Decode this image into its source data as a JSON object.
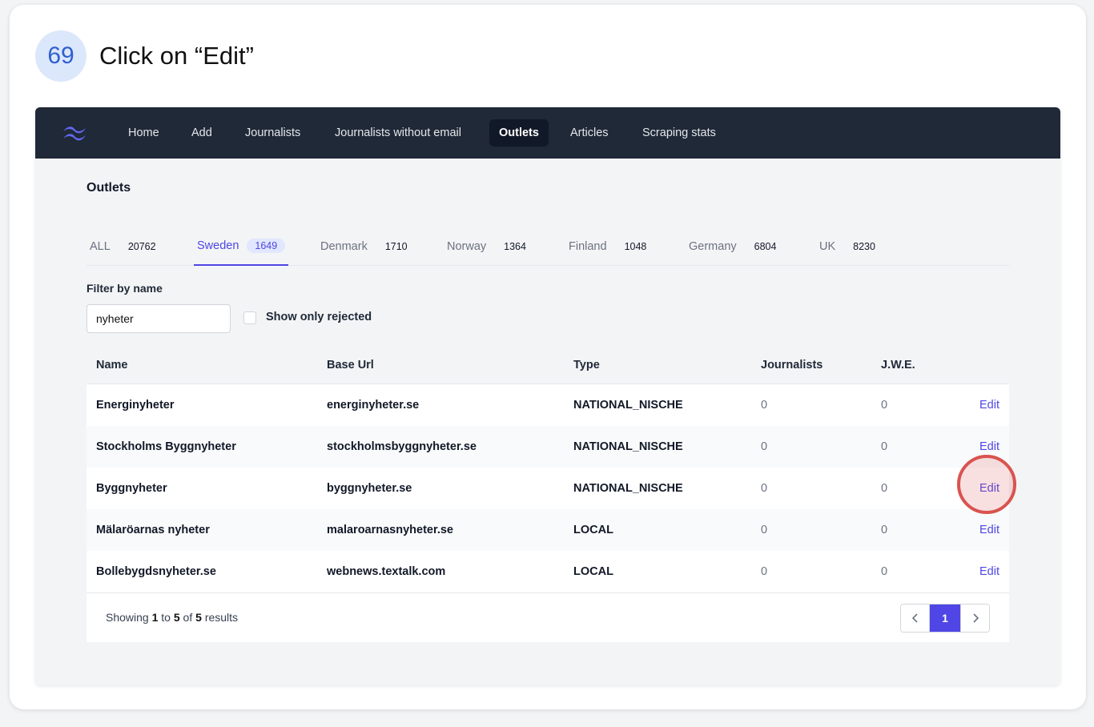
{
  "step": {
    "number": "69",
    "title": "Click on “Edit”"
  },
  "nav": {
    "items": [
      {
        "label": "Home"
      },
      {
        "label": "Add"
      },
      {
        "label": "Journalists"
      },
      {
        "label": "Journalists without email"
      },
      {
        "label": "Outlets",
        "active": true
      },
      {
        "label": "Articles"
      },
      {
        "label": "Scraping stats"
      }
    ]
  },
  "page": {
    "title": "Outlets"
  },
  "tabs": [
    {
      "label": "ALL",
      "count": "20762"
    },
    {
      "label": "Sweden",
      "count": "1649",
      "active": true
    },
    {
      "label": "Denmark",
      "count": "1710"
    },
    {
      "label": "Norway",
      "count": "1364"
    },
    {
      "label": "Finland",
      "count": "1048"
    },
    {
      "label": "Germany",
      "count": "6804"
    },
    {
      "label": "UK",
      "count": "8230"
    }
  ],
  "filter": {
    "label": "Filter by name",
    "value": "nyheter",
    "checkbox_label": "Show only rejected"
  },
  "table": {
    "headers": [
      "Name",
      "Base Url",
      "Type",
      "Journalists",
      "J.W.E."
    ],
    "edit_label": "Edit",
    "rows": [
      {
        "name": "Energinyheter",
        "url": "energinyheter.se",
        "type": "NATIONAL_NISCHE",
        "journalists": "0",
        "jwe": "0"
      },
      {
        "name": "Stockholms Byggnyheter",
        "url": "stockholmsbyggnyheter.se",
        "type": "NATIONAL_NISCHE",
        "journalists": "0",
        "jwe": "0"
      },
      {
        "name": "Byggnyheter",
        "url": "byggnyheter.se",
        "type": "NATIONAL_NISCHE",
        "journalists": "0",
        "jwe": "0"
      },
      {
        "name": "Mälaröarnas nyheter",
        "url": "malaroarnasnyheter.se",
        "type": "LOCAL",
        "journalists": "0",
        "jwe": "0"
      },
      {
        "name": "Bollebygdsnyheter.se",
        "url": "webnews.textalk.com",
        "type": "LOCAL",
        "journalists": "0",
        "jwe": "0"
      }
    ]
  },
  "pagination": {
    "showing_prefix": "Showing",
    "from": "1",
    "to_word": "to",
    "to": "5",
    "of_word": "of",
    "total": "5",
    "suffix": "results",
    "current_page": "1",
    "prev_icon": "chevron-left-icon",
    "next_icon": "chevron-right-icon"
  },
  "colors": {
    "accent": "#4f46e5",
    "nav_bg": "#1f2937",
    "highlight": "#d9534f"
  }
}
